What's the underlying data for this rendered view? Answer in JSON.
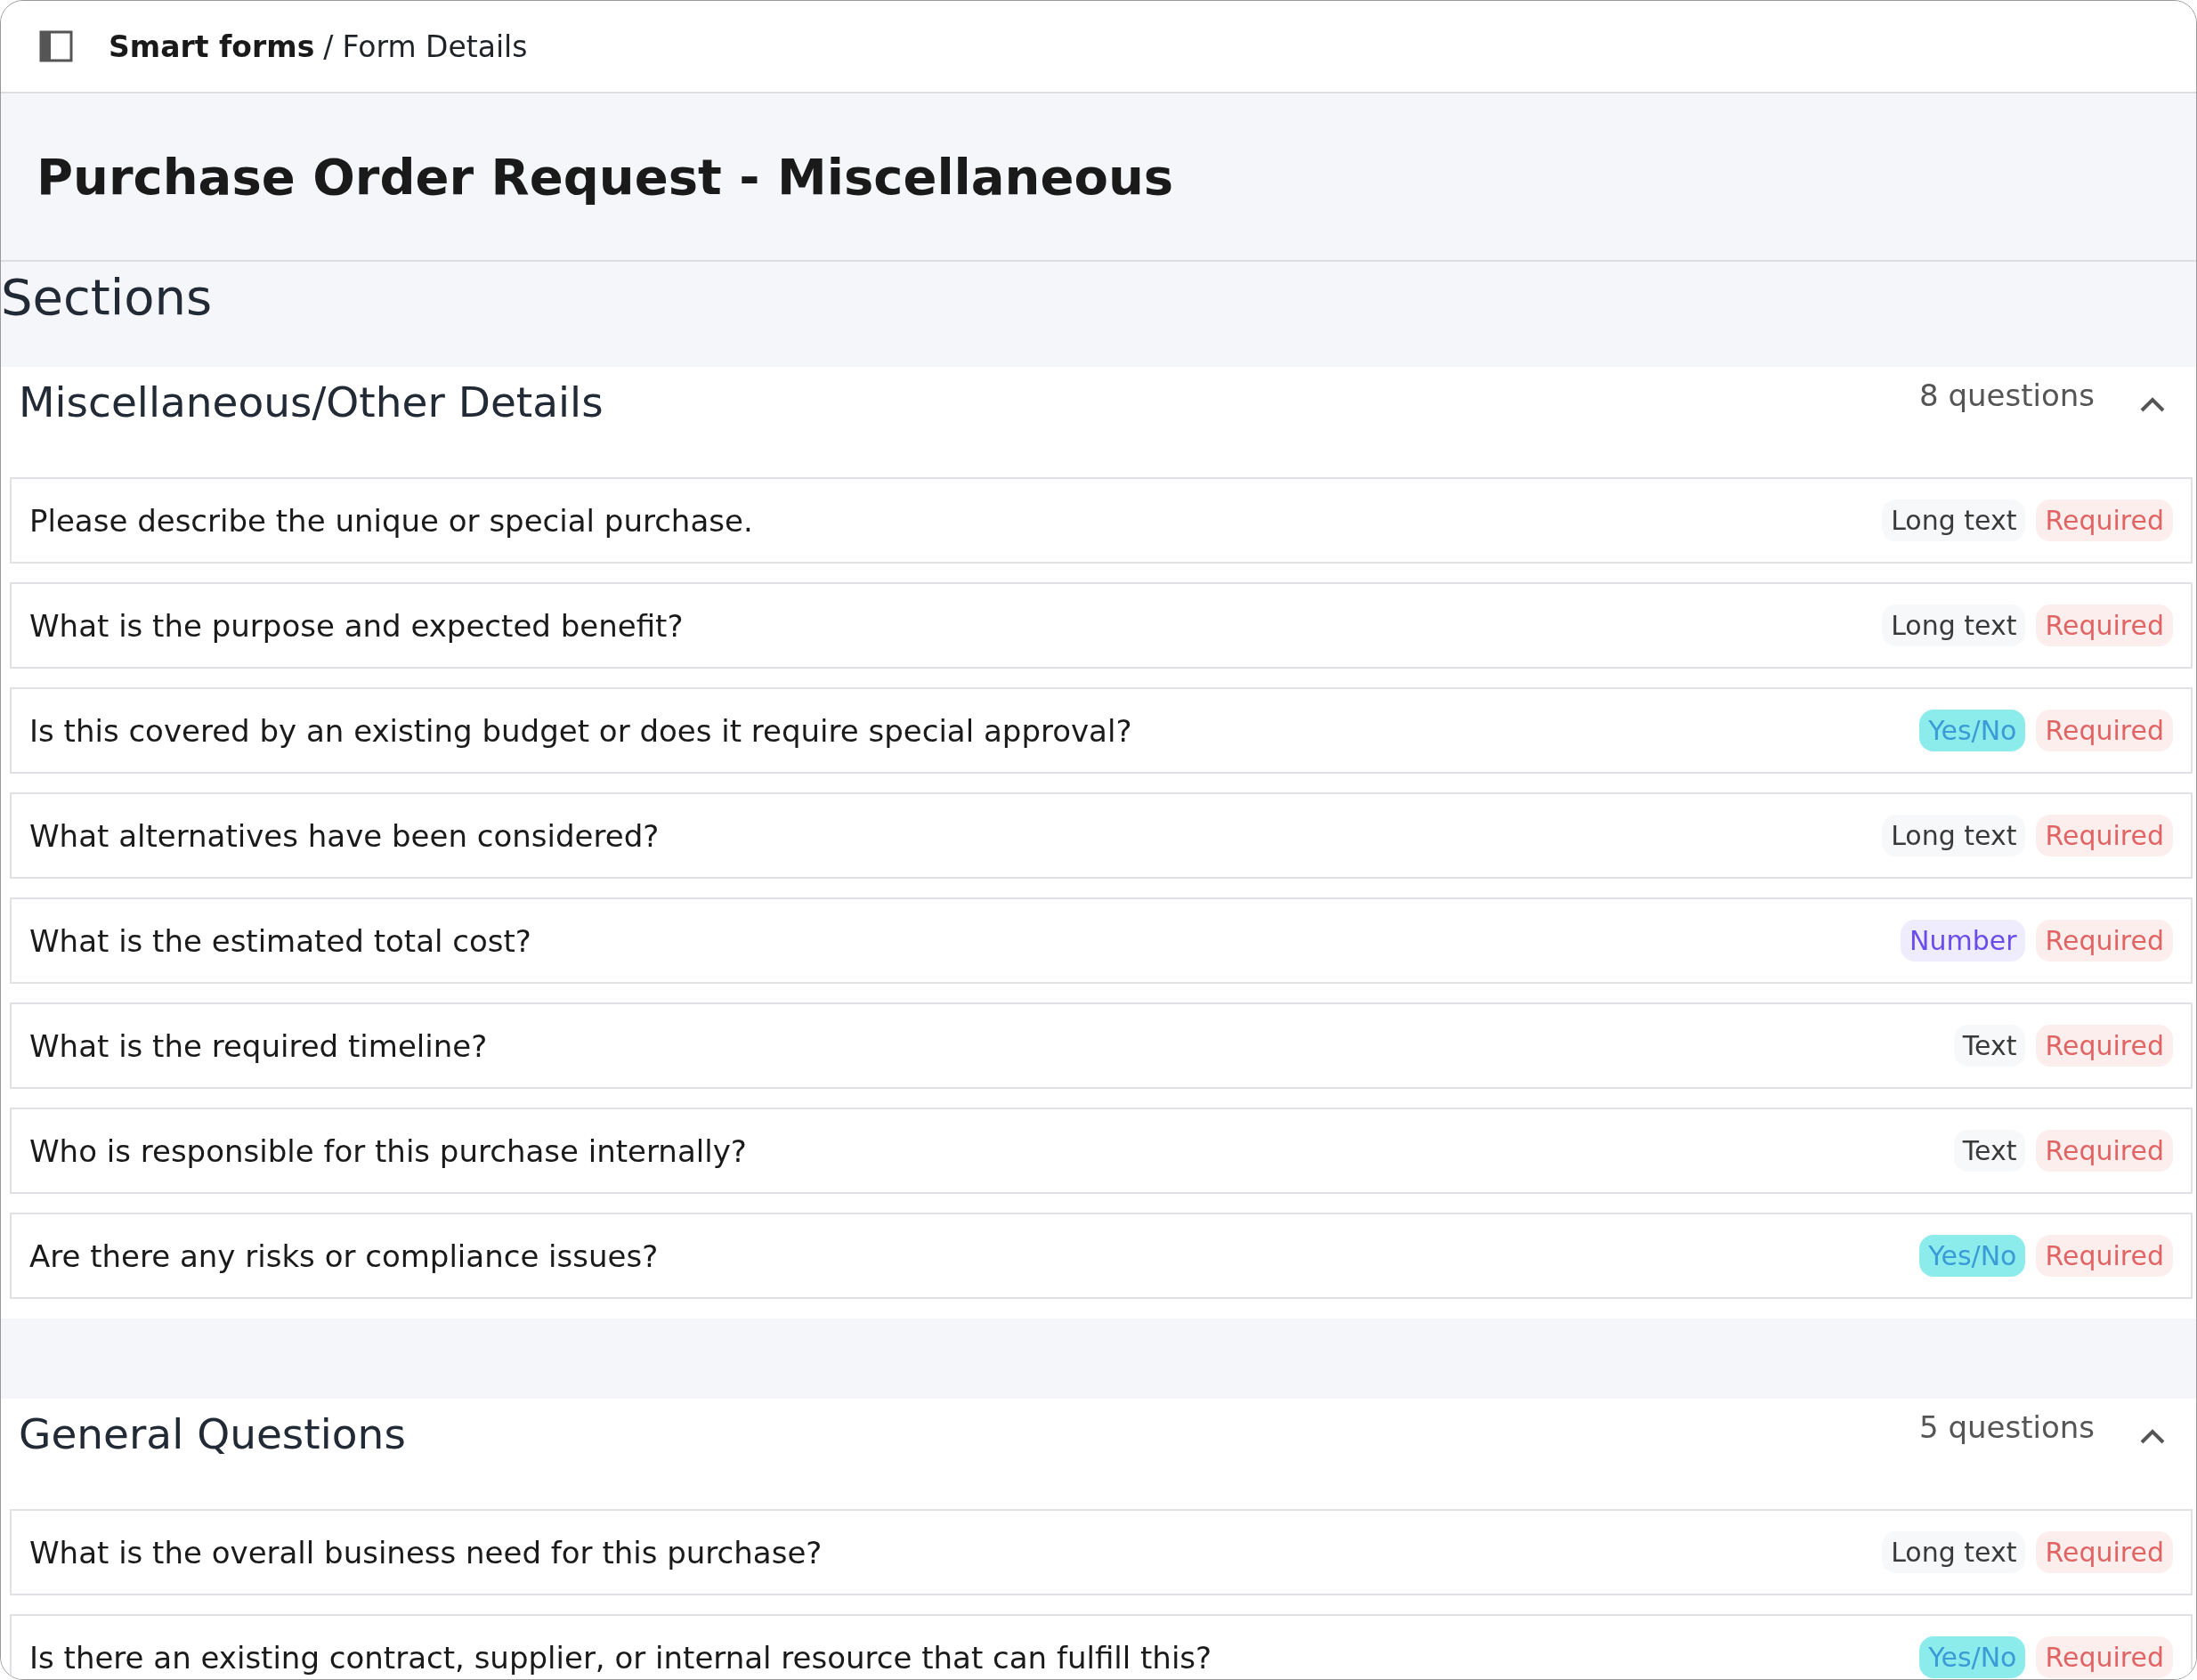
{
  "breadcrumb": {
    "root": "Smart forms",
    "separator": "/",
    "current": "Form Details"
  },
  "title": "Purchase Order Request - Miscellaneous",
  "sections_heading": "Sections",
  "sections": [
    {
      "name": "Miscellaneous/Other Details",
      "count": "8 questions",
      "expanded": true,
      "questions": [
        {
          "text": "Please describe the unique or special purchase.",
          "type": "Long text",
          "kind": "long_text",
          "required_label": "Required",
          "required": true
        },
        {
          "text": "What is the purpose and expected benefit?",
          "type": "Long text",
          "kind": "long_text",
          "required_label": "Required",
          "required": true
        },
        {
          "text": "Is this covered by an existing budget or does it require special approval?",
          "type": "Yes/No",
          "kind": "yes_no",
          "required_label": "Required",
          "required": true
        },
        {
          "text": "What alternatives have been considered?",
          "type": "Long text",
          "kind": "long_text",
          "required_label": "Required",
          "required": true
        },
        {
          "text": "What is the estimated total cost?",
          "type": "Number",
          "kind": "number",
          "required_label": "Required",
          "required": true
        },
        {
          "text": "What is the required timeline?",
          "type": "Text",
          "kind": "text",
          "required_label": "Required",
          "required": true
        },
        {
          "text": "Who is responsible for this purchase internally?",
          "type": "Text",
          "kind": "text",
          "required_label": "Required",
          "required": true
        },
        {
          "text": "Are there any risks or compliance issues?",
          "type": "Yes/No",
          "kind": "yes_no",
          "required_label": "Required",
          "required": true
        }
      ]
    },
    {
      "name": "General Questions",
      "count": "5 questions",
      "expanded": true,
      "questions": [
        {
          "text": "What is the overall business need for this purchase?",
          "type": "Long text",
          "kind": "long_text",
          "required_label": "Required",
          "required": true
        },
        {
          "text": "Is there an existing contract, supplier, or internal resource that can fulfill this?",
          "type": "Yes/No",
          "kind": "yes_no",
          "required_label": "Required",
          "required": true
        }
      ]
    }
  ]
}
